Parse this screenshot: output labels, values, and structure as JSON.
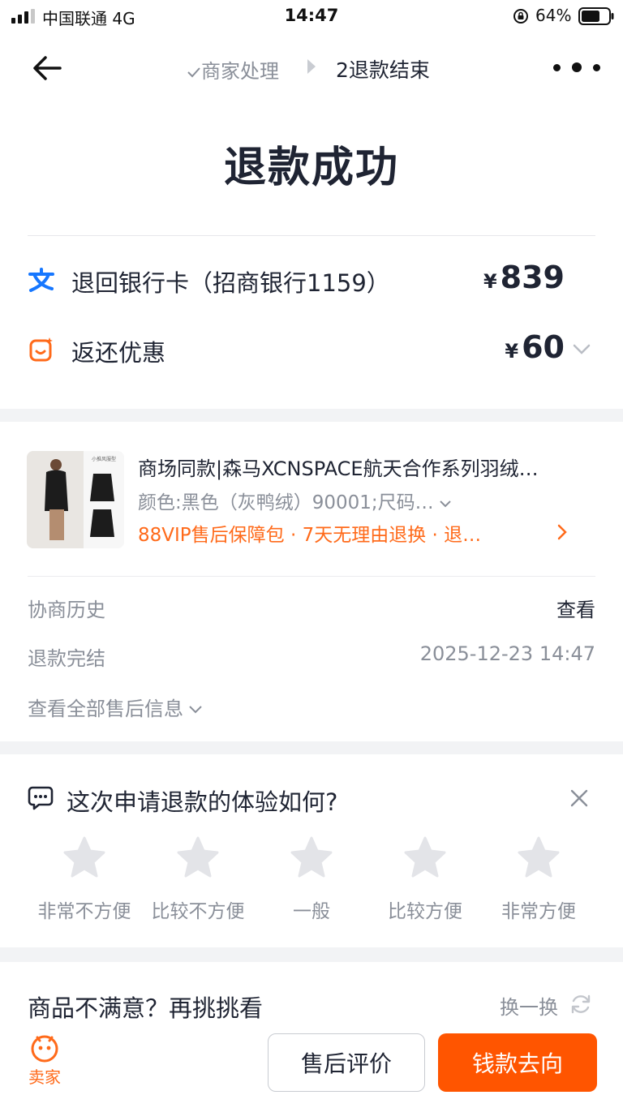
{
  "status_bar": {
    "carrier": "中国联通  4G",
    "time": "14:47",
    "battery_percent": "64%"
  },
  "nav": {
    "crumb_done": "商家处理",
    "crumb_current": "2退款结束"
  },
  "page_title": "退款成功",
  "refunds": [
    {
      "label": "退回银行卡（招商银行1159）",
      "currency": "¥",
      "amount": "839",
      "icon": "alipay-icon"
    },
    {
      "label": "返还优惠",
      "currency": "¥",
      "amount": "60",
      "icon": "coupon-icon"
    }
  ],
  "product": {
    "title": "商场同款|森马XCNSPACE航天合作系列羽绒…",
    "spec": "颜色:黑色（灰鸭绒）90001;尺码…",
    "service": "88VIP售后保障包 · 7天无理由退换 · 退…",
    "thumb_caption": "小推风服型"
  },
  "info": {
    "history_label": "协商历史",
    "history_action": "查看",
    "finish_label": "退款完结",
    "finish_time": "2025-12-23 14:47",
    "view_all": "查看全部售后信息"
  },
  "rating": {
    "question": "这次申请退款的体验如何?",
    "options": [
      "非常不方便",
      "比较不方便",
      "一般",
      "比较方便",
      "非常方便"
    ],
    "selected_stars": 0
  },
  "recommend": {
    "title": "商品不满意？再挑挑看",
    "refresh_label": "换一换"
  },
  "bottom": {
    "seller_label": "卖家",
    "review_button": "售后评价",
    "money_button": "钱款去向"
  },
  "colors": {
    "accent_orange": "#ff5500",
    "service_orange": "#ff6a1a",
    "alipay_blue": "#1677ff",
    "text_primary": "#1f2433",
    "text_secondary": "#8a8f99"
  }
}
